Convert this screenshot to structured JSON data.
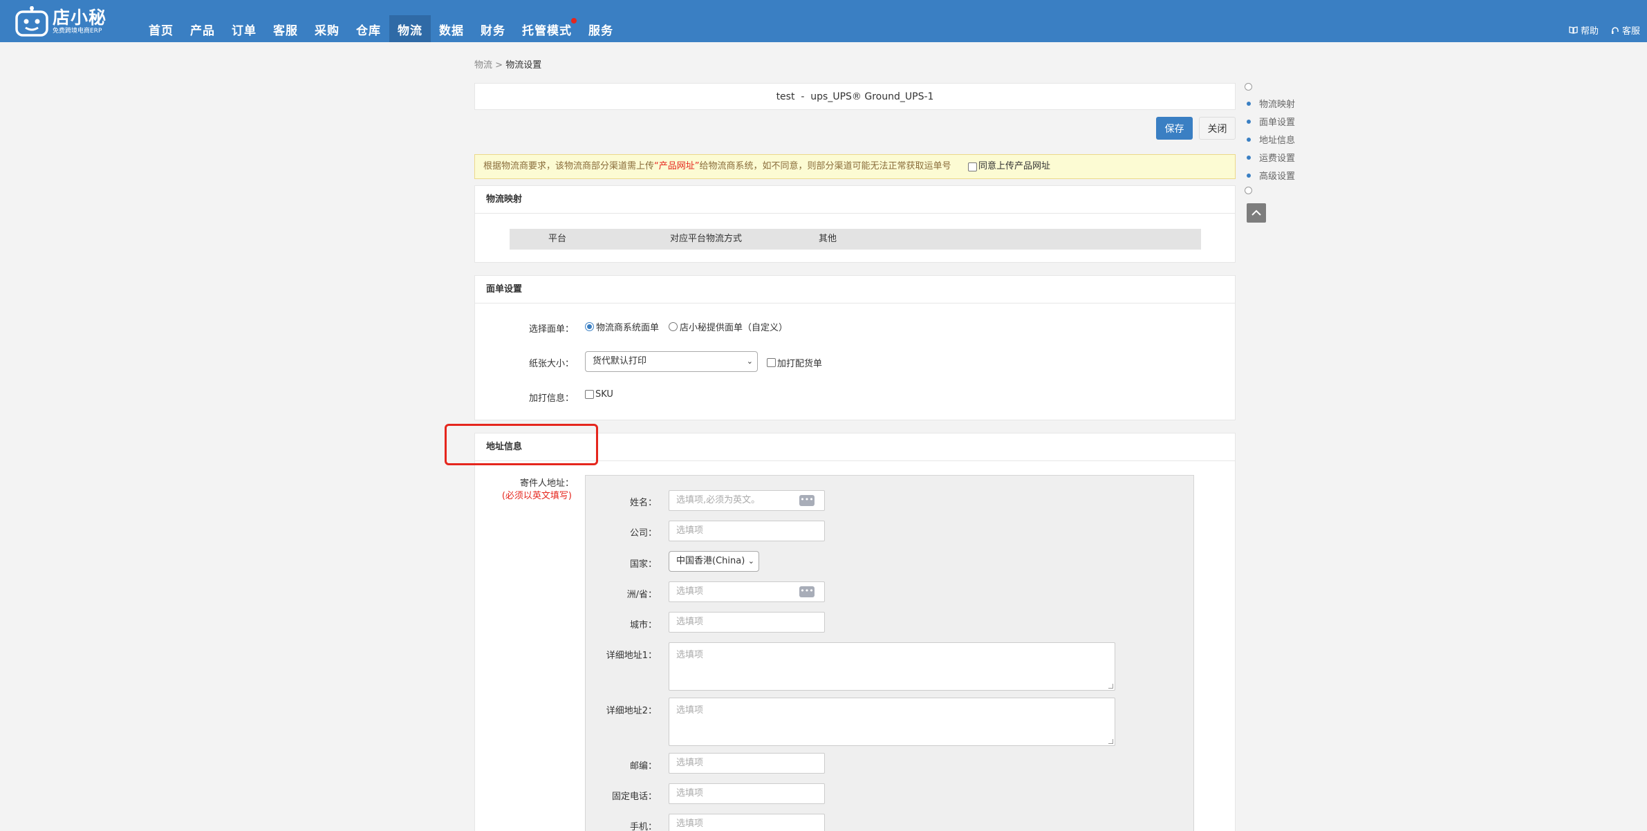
{
  "header": {
    "logo_text": "店小秘",
    "logo_subtext": "免费跨境电商ERP",
    "nav": [
      {
        "label": "首页"
      },
      {
        "label": "产品"
      },
      {
        "label": "订单"
      },
      {
        "label": "客服"
      },
      {
        "label": "采购"
      },
      {
        "label": "仓库"
      },
      {
        "label": "物流",
        "active": true
      },
      {
        "label": "数据"
      },
      {
        "label": "财务"
      },
      {
        "label": "托管模式",
        "badge": true
      },
      {
        "label": "服务"
      }
    ],
    "help_label": "帮助",
    "service_label": "客服",
    "help_icon": "book-icon",
    "service_icon": "headset-icon"
  },
  "breadcrumb": {
    "parent": "物流",
    "sep": ">",
    "current": "物流设置"
  },
  "title": "test  -  ups_UPS® Ground_UPS-1",
  "actions": {
    "save": "保存",
    "close": "关闭"
  },
  "notice": {
    "text_before": "根据物流商要求，该物流商部分渠道需上传",
    "highlight": "“产品网址”",
    "text_after": "给物流商系统，如不同意，则部分渠道可能无法正常获取运单号",
    "agree_label": "同意上传产品网址"
  },
  "mapping": {
    "title": "物流映射",
    "columns": [
      "平台",
      "对应平台物流方式",
      "其他"
    ]
  },
  "waybill": {
    "title": "面单设置",
    "select_label": "选择面单：",
    "option1": "物流商系统面单",
    "option2": "店小秘提供面单（自定义）",
    "paper_label": "纸张大小：",
    "paper_value": "货代默认打印",
    "extra_print_label": "加打配货单",
    "print_info_label": "加打信息：",
    "sku_label": "SKU"
  },
  "address": {
    "title": "地址信息",
    "sender_label": "寄件人地址：",
    "sender_note": "(必须以英文填写)",
    "fields": {
      "name_label": "姓名：",
      "name_placeholder": "选填项,必须为英文。",
      "company_label": "公司：",
      "company_placeholder": "选填项",
      "country_label": "国家：",
      "country_value": "中国香港(China)",
      "state_label": "洲/省：",
      "state_placeholder": "选填项",
      "city_label": "城市：",
      "city_placeholder": "选填项",
      "addr1_label": "详细地址1：",
      "addr1_placeholder": "选填项",
      "addr2_label": "详细地址2：",
      "addr2_placeholder": "选填项",
      "zip_label": "邮编：",
      "zip_placeholder": "选填项",
      "phone_label": "固定电话：",
      "phone_placeholder": "选填项",
      "mobile_label": "手机：",
      "mobile_placeholder": "选填项"
    }
  },
  "anchor_nav": [
    "物流映射",
    "面单设置",
    "地址信息",
    "运费设置",
    "高级设置"
  ],
  "colors": {
    "brand": "#3a7fc3",
    "alert": "#e5261d",
    "notice_bg": "#fcfbd3"
  }
}
